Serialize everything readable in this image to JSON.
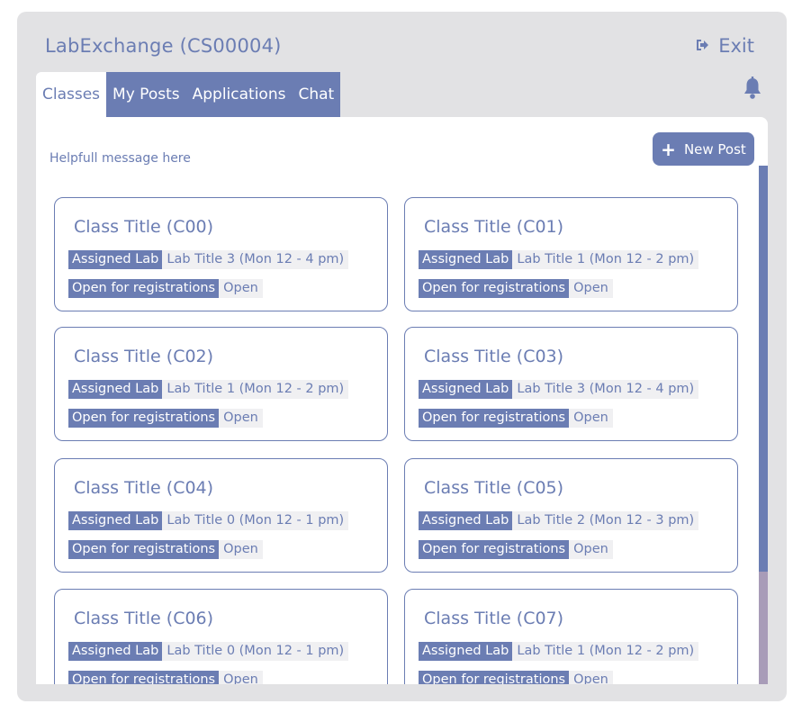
{
  "app": {
    "title": "LabExchange (CS00004)",
    "exit_label": "Exit"
  },
  "tabs": [
    {
      "label": "Classes",
      "active": true
    },
    {
      "label": "My Posts",
      "active": false
    },
    {
      "label": "Applications",
      "active": false
    },
    {
      "label": "Chat",
      "active": false
    }
  ],
  "main": {
    "help_message": "Helpfull message here",
    "new_post_label": "New Post"
  },
  "cards": [
    {
      "title": "Class Title (C00)",
      "lab_label": "Assigned Lab",
      "lab": "Lab Title 3 (Mon 12 - 4 pm)",
      "reg_label": "Open for registrations",
      "reg": "Open"
    },
    {
      "title": "Class Title (C01)",
      "lab_label": "Assigned Lab",
      "lab": "Lab Title 1 (Mon 12 - 2 pm)",
      "reg_label": "Open for registrations",
      "reg": "Open"
    },
    {
      "title": "Class Title (C02)",
      "lab_label": "Assigned Lab",
      "lab": "Lab Title 1 (Mon 12 - 2 pm)",
      "reg_label": "Open for registrations",
      "reg": "Open"
    },
    {
      "title": "Class Title (C03)",
      "lab_label": "Assigned Lab",
      "lab": "Lab Title 3 (Mon 12 - 4 pm)",
      "reg_label": "Open for registrations",
      "reg": "Open"
    },
    {
      "title": "Class Title (C04)",
      "lab_label": "Assigned Lab",
      "lab": "Lab Title 0 (Mon 12 - 1 pm)",
      "reg_label": "Open for registrations",
      "reg": "Open"
    },
    {
      "title": "Class Title (C05)",
      "lab_label": "Assigned Lab",
      "lab": "Lab Title 2 (Mon 12 - 3 pm)",
      "reg_label": "Open for registrations",
      "reg": "Open"
    },
    {
      "title": "Class Title (C06)",
      "lab_label": "Assigned Lab",
      "lab": "Lab Title 0 (Mon 12 - 1 pm)",
      "reg_label": "Open for registrations",
      "reg": "Open"
    },
    {
      "title": "Class Title (C07)",
      "lab_label": "Assigned Lab",
      "lab": "Lab Title 1 (Mon 12 - 2 pm)",
      "reg_label": "Open for registrations",
      "reg": "Open"
    }
  ],
  "icons": {
    "exit": "exit-icon",
    "bell": "bell-icon",
    "plus": "plus-icon"
  },
  "colors": {
    "accent": "#6b7db3",
    "window_bg": "#e2e2e4",
    "scroll_track": "#a89cb8"
  }
}
